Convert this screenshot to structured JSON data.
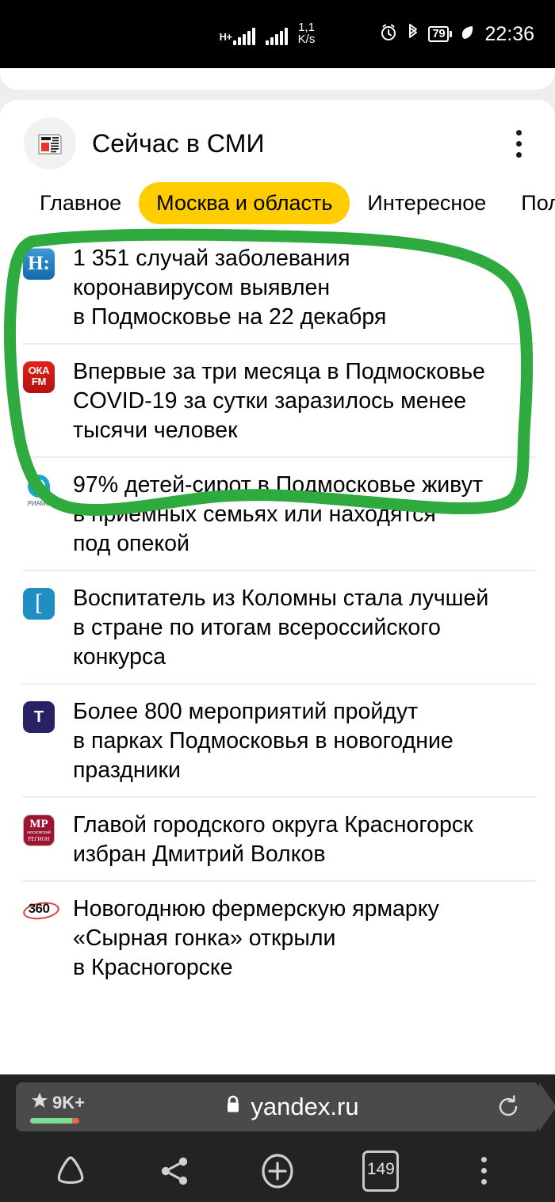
{
  "status_bar": {
    "network_type": "H+",
    "data_rate": "1,1",
    "data_rate_unit": "K/s",
    "battery_percent": "79",
    "clock": "22:36",
    "icons": [
      "signal-bars-icon",
      "signal-bars-icon",
      "alarm-clock-icon",
      "bluetooth-icon",
      "battery-icon",
      "leaf-power-saving-icon"
    ]
  },
  "feed": {
    "title": "Сейчас в СМИ",
    "logo_icon": "newspaper-icon",
    "menu_icon": "kebab-menu-icon",
    "tabs": [
      {
        "label": "Главное",
        "active": false
      },
      {
        "label": "Москва и область",
        "active": true
      },
      {
        "label": "Интересное",
        "active": false
      },
      {
        "label": "Пол",
        "active": false
      }
    ],
    "active_tab_color": "#ffcc00",
    "items": [
      {
        "source": "nsn",
        "source_icon": "nsn-logo-icon",
        "lines": [
          "1 351 случай заболевания",
          "коронавирусом выявлен",
          "в Подмосковье на 22 декабря"
        ]
      },
      {
        "source": "oka-fm",
        "source_icon": "oka-fm-logo-icon",
        "source_text_top": "ОКА",
        "source_text_bottom": "FM",
        "lines": [
          "Впервые за три месяца в Подмосковье",
          "COVID-19 за сутки заразилось менее",
          "тысячи человек"
        ]
      },
      {
        "source": "riamo",
        "source_icon": "riamo-logo-icon",
        "source_caption": "РИАМО",
        "lines": [
          "97% детей-сирот в Подмосковье живут",
          "в приемных семьях или находятся",
          "под опекой"
        ]
      },
      {
        "source": "izvestia",
        "source_icon": "izvestia-logo-icon",
        "source_glyph": "[",
        "lines": [
          "Воспитатель из Коломны стала лучшей",
          "в стране по итогам всероссийского",
          "конкурса"
        ]
      },
      {
        "source": "tsargrad",
        "source_icon": "tsargrad-logo-icon",
        "source_glyph": "T",
        "lines": [
          "Более 800 мероприятий пройдут",
          "в парках Подмосковья в новогодние",
          "праздники"
        ]
      },
      {
        "source": "mosregion",
        "source_icon": "mosregion-logo-icon",
        "source_glyph": "МР",
        "source_sub": "МОСКОВСКИЙ",
        "source_caption": "РЕГИОН",
        "lines": [
          "Главой городского округа Красногорск",
          "избран Дмитрий Волков"
        ]
      },
      {
        "source": "360",
        "source_icon": "tv360-logo-icon",
        "source_glyph": "360",
        "lines": [
          "Новогоднюю фермерскую ярмарку",
          "«Сырная гонка» открыли",
          "в Красногорске"
        ]
      }
    ]
  },
  "annotation": {
    "type": "hand-drawn-circle",
    "color": "#2eaa3f",
    "encircles": "first two news items"
  },
  "browser": {
    "url": "yandex.ru",
    "lock_icon": "lock-icon",
    "reload_icon": "reload-icon",
    "adblock_count": "9K+",
    "adblock_star_icon": "star-icon",
    "nav": [
      {
        "icon": "home-triangle-icon",
        "label": ""
      },
      {
        "icon": "share-icon",
        "label": ""
      },
      {
        "icon": "new-tab-plus-icon",
        "label": ""
      },
      {
        "icon": "tab-counter-icon",
        "label": "149"
      },
      {
        "icon": "kebab-menu-icon",
        "label": ""
      }
    ]
  }
}
